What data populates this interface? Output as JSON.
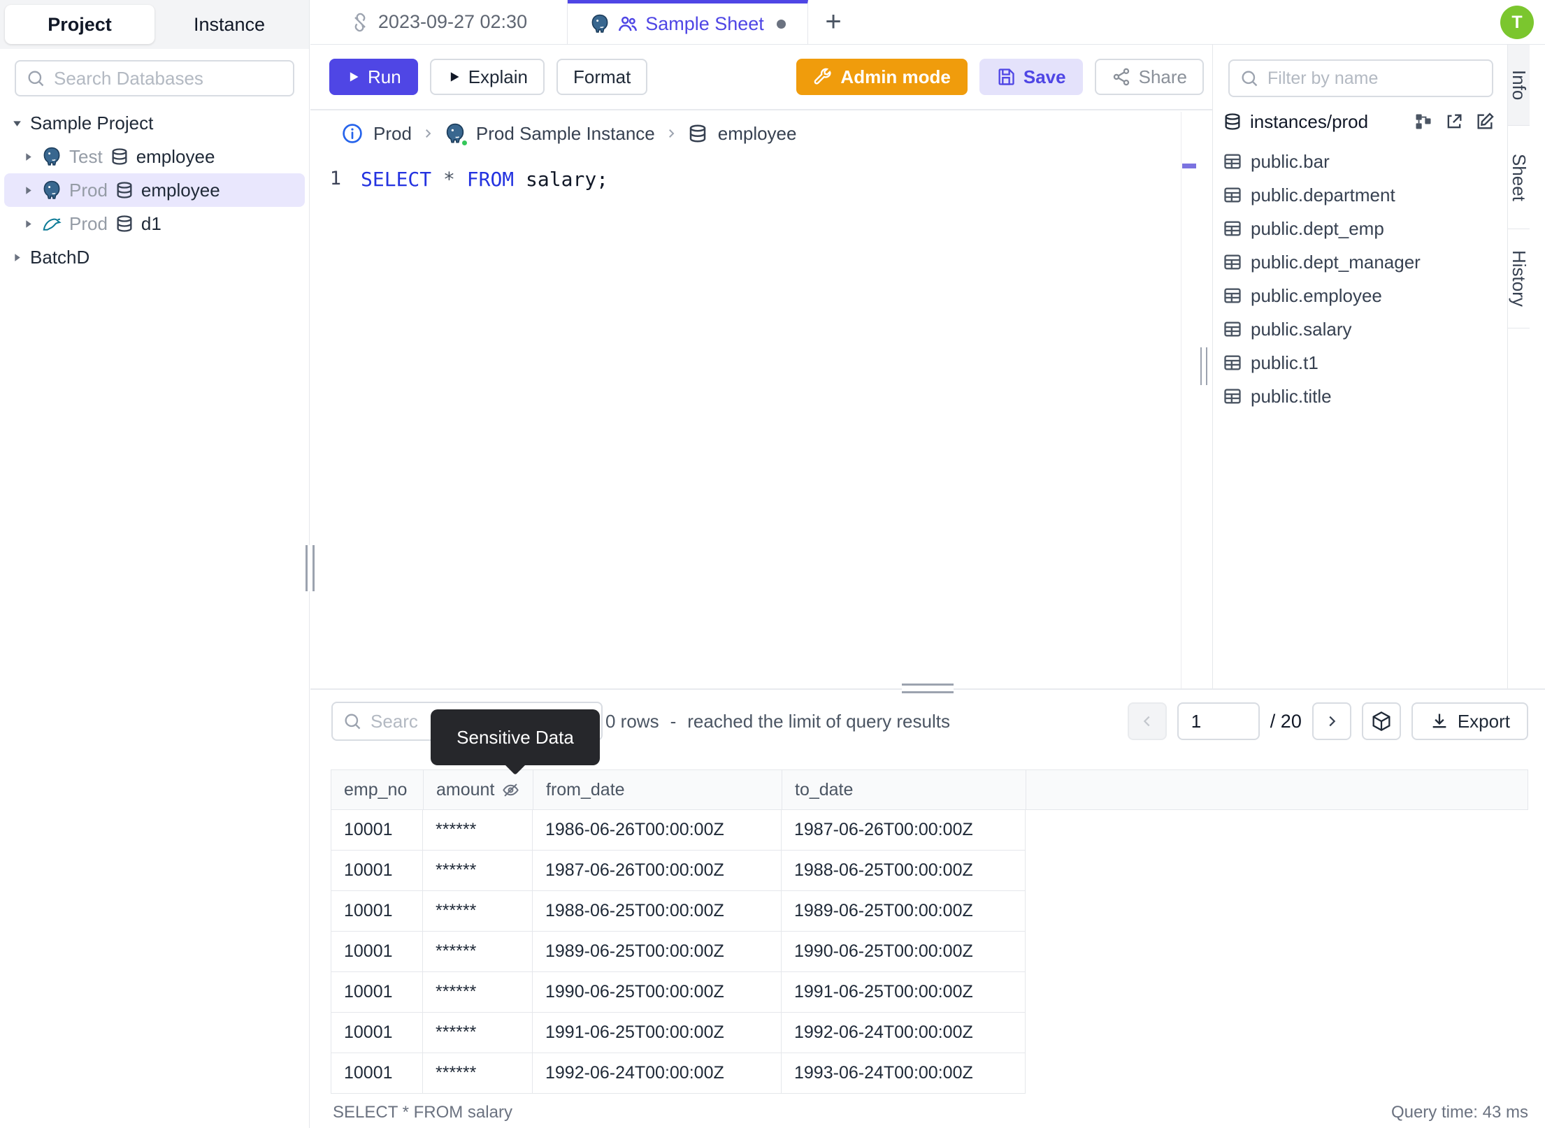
{
  "left_sidebar": {
    "tabs": [
      {
        "label": "Project"
      },
      {
        "label": "Instance"
      }
    ],
    "search_placeholder": "Search Databases",
    "tree": {
      "project_label": "Sample Project",
      "items": [
        {
          "env": "Test",
          "engine": "postgres",
          "name": "employee"
        },
        {
          "env": "Prod",
          "engine": "postgres",
          "name": "employee"
        },
        {
          "env": "Prod",
          "engine": "mysql",
          "name": "d1"
        }
      ],
      "batch_label": "BatchD"
    }
  },
  "tab_bar": {
    "history_tab_label": "2023-09-27 02:30",
    "active_tab_label": "Sample Sheet",
    "new_tab_label": "+"
  },
  "avatar_initial": "T",
  "toolbar": {
    "run": "Run",
    "explain": "Explain",
    "format": "Format",
    "admin_mode": "Admin mode",
    "save": "Save",
    "share": "Share"
  },
  "breadcrumb": {
    "env": "Prod",
    "instance": "Prod Sample Instance",
    "database": "employee"
  },
  "editor": {
    "line_number": "1",
    "kw1": "SELECT",
    "star": " * ",
    "kw2": "FROM",
    "rest": " salary;"
  },
  "right_sidebar": {
    "filter_placeholder": "Filter by name",
    "instance_path": "instances/prod",
    "tables": [
      "public.bar",
      "public.department",
      "public.dept_emp",
      "public.dept_manager",
      "public.employee",
      "public.salary",
      "public.t1",
      "public.title"
    ]
  },
  "rail": {
    "tabs": [
      "Info",
      "Sheet",
      "History"
    ]
  },
  "results": {
    "search_placeholder": "Searc",
    "tooltip": "Sensitive Data",
    "summary_count": "0 rows",
    "summary_sep": "-",
    "summary_text": "reached the limit of query results",
    "page": "1",
    "page_total": "/ 20",
    "export_label": "Export",
    "columns": [
      "emp_no",
      "amount",
      "from_date",
      "to_date"
    ],
    "rows": [
      [
        "10001",
        "******",
        "1986-06-26T00:00:00Z",
        "1987-06-26T00:00:00Z"
      ],
      [
        "10001",
        "******",
        "1987-06-26T00:00:00Z",
        "1988-06-25T00:00:00Z"
      ],
      [
        "10001",
        "******",
        "1988-06-25T00:00:00Z",
        "1989-06-25T00:00:00Z"
      ],
      [
        "10001",
        "******",
        "1989-06-25T00:00:00Z",
        "1990-06-25T00:00:00Z"
      ],
      [
        "10001",
        "******",
        "1990-06-25T00:00:00Z",
        "1991-06-25T00:00:00Z"
      ],
      [
        "10001",
        "******",
        "1991-06-25T00:00:00Z",
        "1992-06-24T00:00:00Z"
      ],
      [
        "10001",
        "******",
        "1992-06-24T00:00:00Z",
        "1993-06-24T00:00:00Z"
      ]
    ],
    "status_left": "SELECT * FROM salary",
    "status_right": "Query time: 43 ms"
  },
  "colors": {
    "accent": "#4f46e5",
    "admin_orange": "#f09c0c",
    "save_bg": "#e4e2fb",
    "avatar_green": "#7bc62e",
    "selected_tree_row": "#e9e7fd",
    "sql_keyword": "#2433e0",
    "tooltip_bg": "#26272b"
  }
}
